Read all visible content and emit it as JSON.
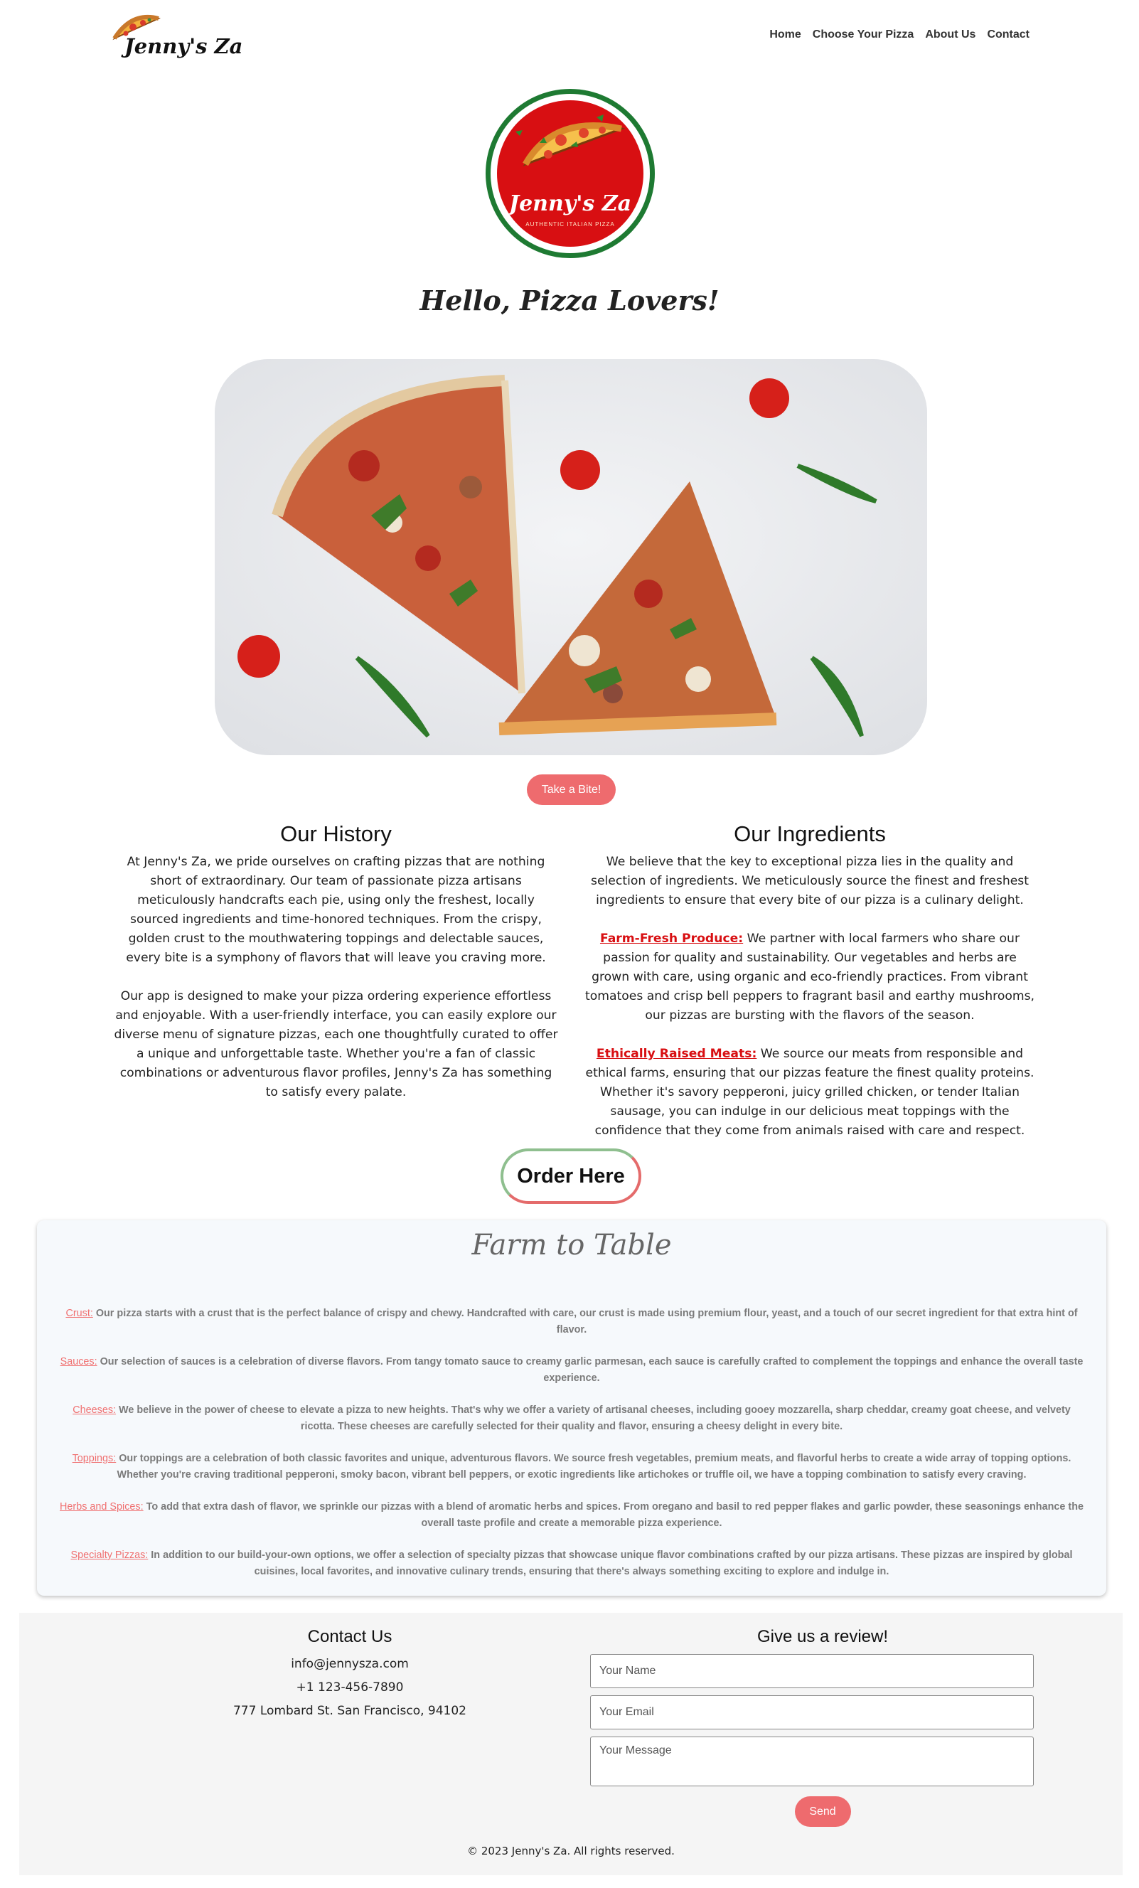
{
  "brand": {
    "name": "Jenny's Za",
    "logo_icon": "pizza-slice-icon"
  },
  "nav": {
    "items": [
      {
        "label": "Home"
      },
      {
        "label": "Choose Your Pizza"
      },
      {
        "label": "About Us"
      },
      {
        "label": "Contact"
      }
    ]
  },
  "logo": {
    "name": "Jenny's Za",
    "tagline": "AUTHENTIC ITALIAN PIZZA",
    "ring_color": "#1e7a32",
    "fill_color": "#d80f12"
  },
  "hero": {
    "greeting": "Hello, Pizza Lovers!",
    "image_subject": "two pizza slices with cherry tomatoes and arugula",
    "cta_label": "Take a Bite!"
  },
  "history": {
    "title": "Our History",
    "paragraphs": [
      "At Jenny's Za, we pride ourselves on crafting pizzas that are nothing short of extraordinary. Our team of passionate pizza artisans meticulously handcrafts each pie, using only the freshest, locally sourced ingredients and time-honored techniques. From the crispy, golden crust to the mouthwatering toppings and delectable sauces, every bite is a symphony of flavors that will leave you craving more.",
      "Our app is designed to make your pizza ordering experience effortless and enjoyable. With a user-friendly interface, you can easily explore our diverse menu of signature pizzas, each one thoughtfully curated to offer a unique and unforgettable taste. Whether you're a fan of classic combinations or adventurous flavor profiles, Jenny's Za has something to satisfy every palate."
    ]
  },
  "ingredients": {
    "title": "Our Ingredients",
    "intro": "We believe that the key to exceptional pizza lies in the quality and selection of ingredients. We meticulously source the finest and freshest ingredients to ensure that every bite of our pizza is a culinary delight.",
    "produce_label": "Farm-Fresh Produce:",
    "produce_text": " We partner with local farmers who share our passion for quality and sustainability. Our vegetables and herbs are grown with care, using organic and eco-friendly practices. From vibrant tomatoes and crisp bell peppers to fragrant basil and earthy mushrooms, our pizzas are bursting with the flavors of the season.",
    "meats_label": "Ethically Raised Meats:",
    "meats_text": " We source our meats from responsible and ethical farms, ensuring that our pizzas feature the finest quality proteins. Whether it's savory pepperoni, juicy grilled chicken, or tender Italian sausage, you can indulge in our delicious meat toppings with the confidence that they come from animals raised with care and respect."
  },
  "order": {
    "label": "Order Here"
  },
  "farm": {
    "title": "Farm to Table",
    "items": [
      {
        "key": "Crust:",
        "text": " Our pizza starts with a crust that is the perfect balance of crispy and chewy. Handcrafted with care, our crust is made using premium flour, yeast, and a touch of our secret ingredient for that extra hint of flavor."
      },
      {
        "key": "Sauces:",
        "text": " Our selection of sauces is a celebration of diverse flavors. From tangy tomato sauce to creamy garlic parmesan, each sauce is carefully crafted to complement the toppings and enhance the overall taste experience."
      },
      {
        "key": "Cheeses:",
        "text": " We believe in the power of cheese to elevate a pizza to new heights. That's why we offer a variety of artisanal cheeses, including gooey mozzarella, sharp cheddar, creamy goat cheese, and velvety ricotta. These cheeses are carefully selected for their quality and flavor, ensuring a cheesy delight in every bite."
      },
      {
        "key": "Toppings:",
        "text": " Our toppings are a celebration of both classic favorites and unique, adventurous flavors. We source fresh vegetables, premium meats, and flavorful herbs to create a wide array of topping options. Whether you're craving traditional pepperoni, smoky bacon, vibrant bell peppers, or exotic ingredients like artichokes or truffle oil, we have a topping combination to satisfy every craving."
      },
      {
        "key": "Herbs and Spices:",
        "text": " To add that extra dash of flavor, we sprinkle our pizzas with a blend of aromatic herbs and spices. From oregano and basil to red pepper flakes and garlic powder, these seasonings enhance the overall taste profile and create a memorable pizza experience."
      },
      {
        "key": "Specialty Pizzas:",
        "text": " In addition to our build-your-own options, we offer a selection of specialty pizzas that showcase unique flavor combinations crafted by our pizza artisans. These pizzas are inspired by global cuisines, local favorites, and innovative culinary trends, ensuring that there's always something exciting to explore and indulge in."
      }
    ]
  },
  "contact": {
    "title": "Contact Us",
    "email": "info@jennysza.com",
    "phone": "+1 123-456-7890",
    "address": "777 Lombard St. San Francisco, 94102"
  },
  "review": {
    "title": "Give us a review!",
    "name_placeholder": "Your Name",
    "email_placeholder": "Your Email",
    "message_placeholder": "Your Message",
    "send_label": "Send"
  },
  "footer": {
    "copyright": "© 2023 Jenny's Za. All rights reserved."
  },
  "colors": {
    "accent": "#ee6b6e",
    "brand_red": "#d80f12",
    "brand_green": "#1e7a32",
    "farm_bg": "#f6f9fc",
    "footer_bg": "#f5f5f5"
  }
}
